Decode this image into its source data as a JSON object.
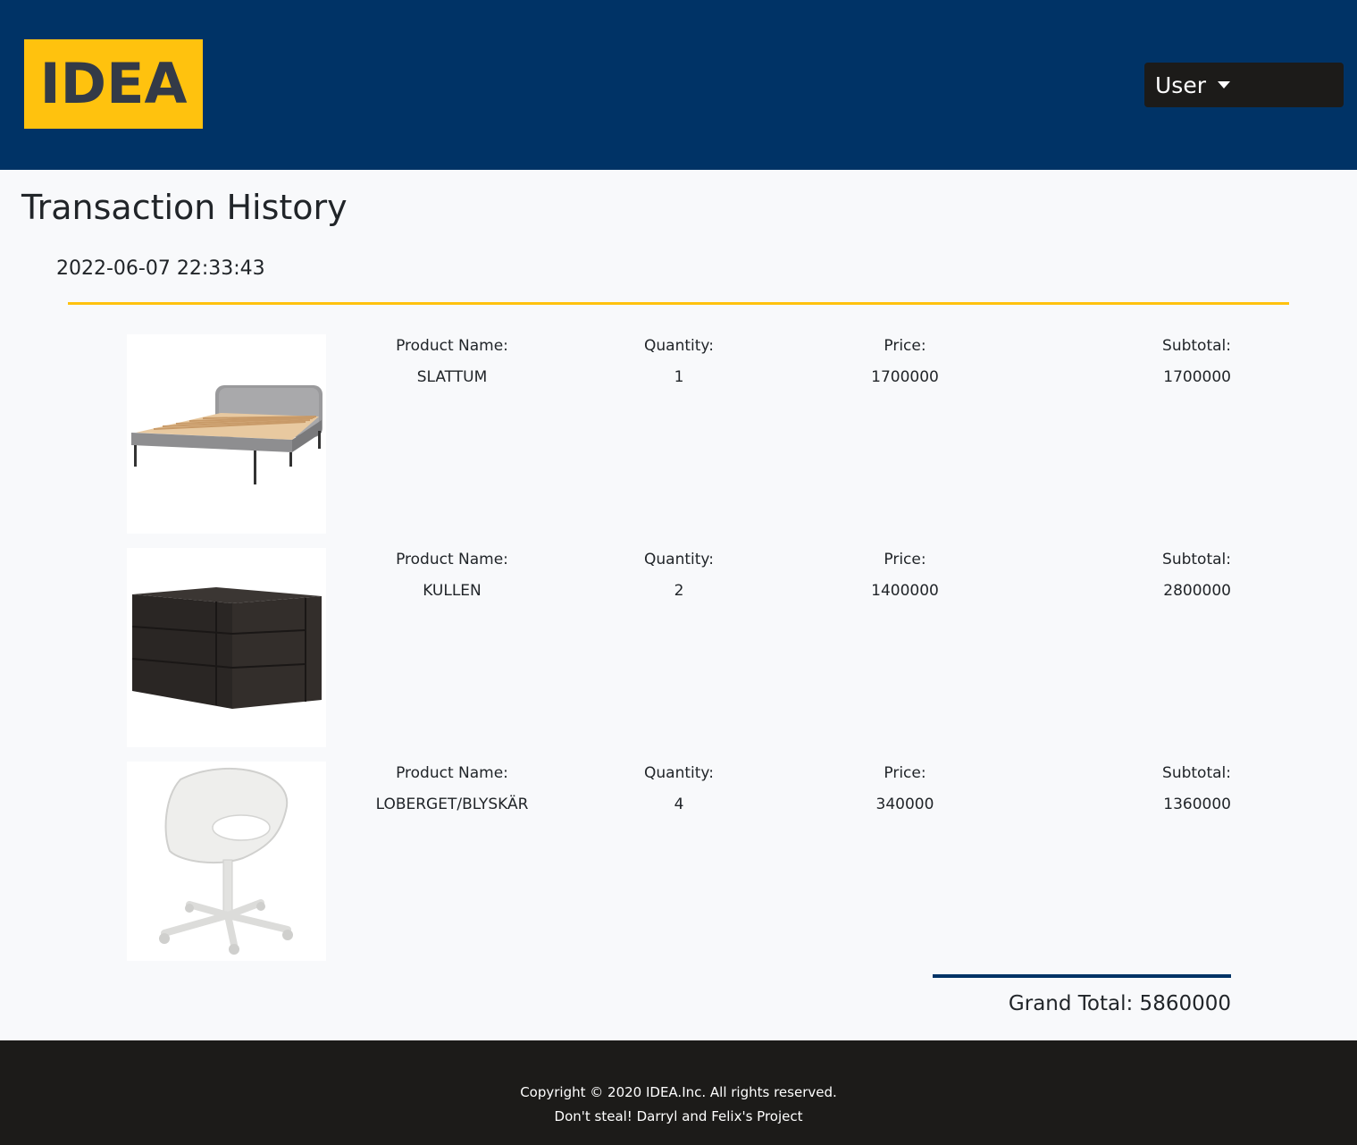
{
  "header": {
    "logo_text": "IDEA",
    "user_menu_label": "User"
  },
  "page": {
    "title": "Transaction History"
  },
  "transaction": {
    "date": "2022-06-07 22:33:43",
    "labels": {
      "name": "Product Name:",
      "quantity": "Quantity:",
      "price": "Price:",
      "subtotal": "Subtotal:"
    },
    "items": [
      {
        "name": "SLATTUM",
        "quantity": "1",
        "price": "1700000",
        "subtotal": "1700000",
        "image_icon": "bed-image"
      },
      {
        "name": "KULLEN",
        "quantity": "2",
        "price": "1400000",
        "subtotal": "2800000",
        "image_icon": "dresser-image"
      },
      {
        "name": "LOBERGET/BLYSKÄR",
        "quantity": "4",
        "price": "340000",
        "subtotal": "1360000",
        "image_icon": "chair-image"
      }
    ],
    "grand_total": "Grand Total: 5860000"
  },
  "footer": {
    "copyright": "Copyright © 2020 IDEA.Inc. All rights reserved.",
    "credit": "Don't steal! Darryl and Felix's Project"
  },
  "colors": {
    "header_bg": "#003366",
    "logo_bg": "#ffc20e",
    "logo_text": "#333a47",
    "user_btn_bg": "#1c1b19",
    "accent_rule": "#ffc20e",
    "total_rule": "#003366",
    "footer_bg": "#1c1b19"
  }
}
